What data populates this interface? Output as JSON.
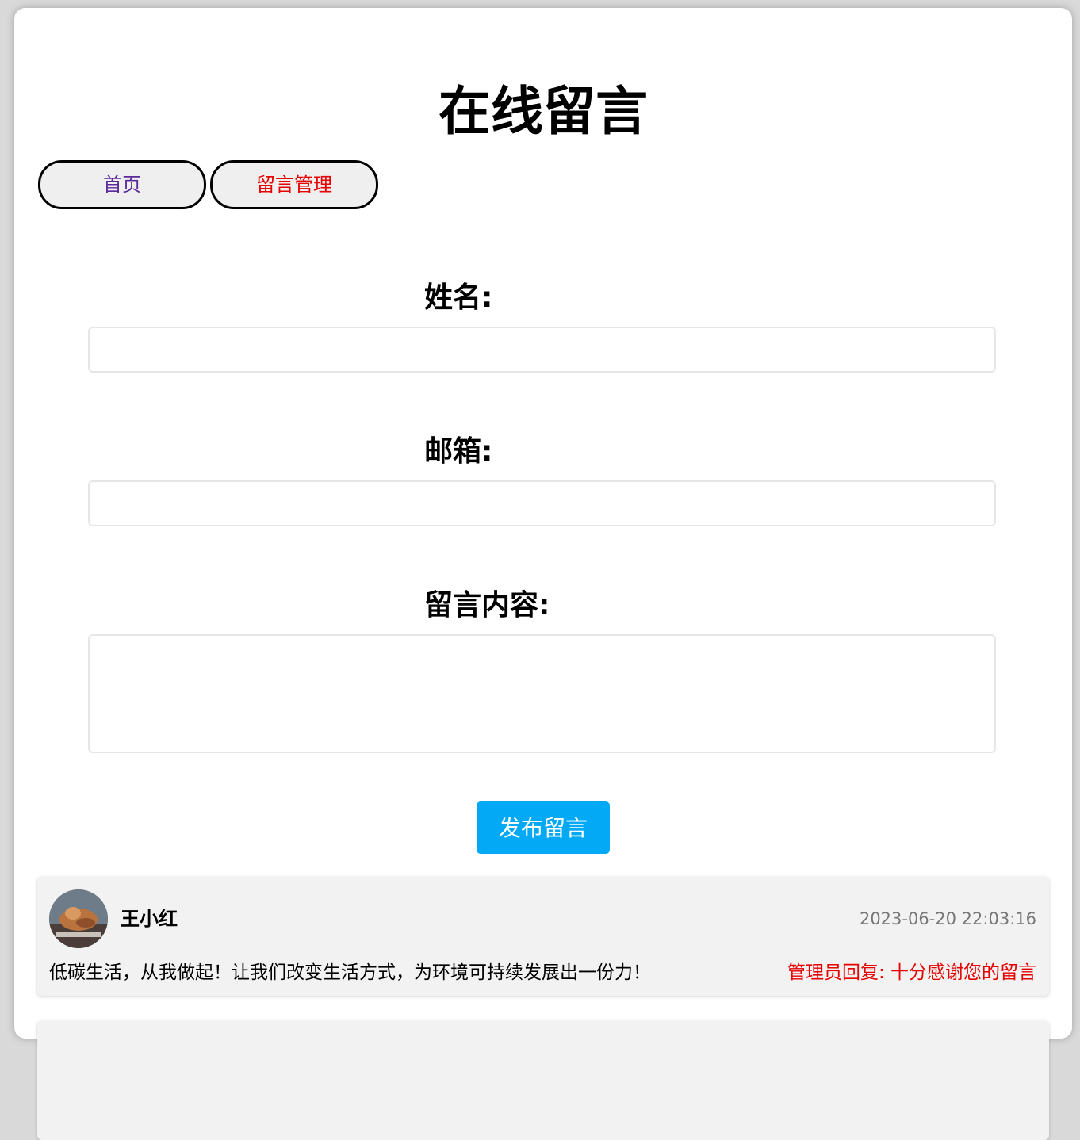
{
  "page": {
    "title": "在线留言"
  },
  "nav": {
    "home_label": "首页",
    "manage_label": "留言管理"
  },
  "form": {
    "name_label": "姓名:",
    "email_label": "邮箱:",
    "content_label": "留言内容:",
    "name_value": "",
    "email_value": "",
    "content_value": "",
    "submit_label": "发布留言"
  },
  "messages": [
    {
      "author": "王小红",
      "time": "2023-06-20 22:03:16",
      "content": "低碳生活，从我做起！让我们改变生活方式，为环境可持续发展出一份力！",
      "reply": "管理员回复: 十分感谢您的留言"
    }
  ],
  "colors": {
    "submit_bg": "#03a9f4",
    "reply_text": "#e60000",
    "nav_home_text": "#5a2a9a",
    "nav_manage_text": "#e60000",
    "card_bg": "#f2f2f2"
  }
}
